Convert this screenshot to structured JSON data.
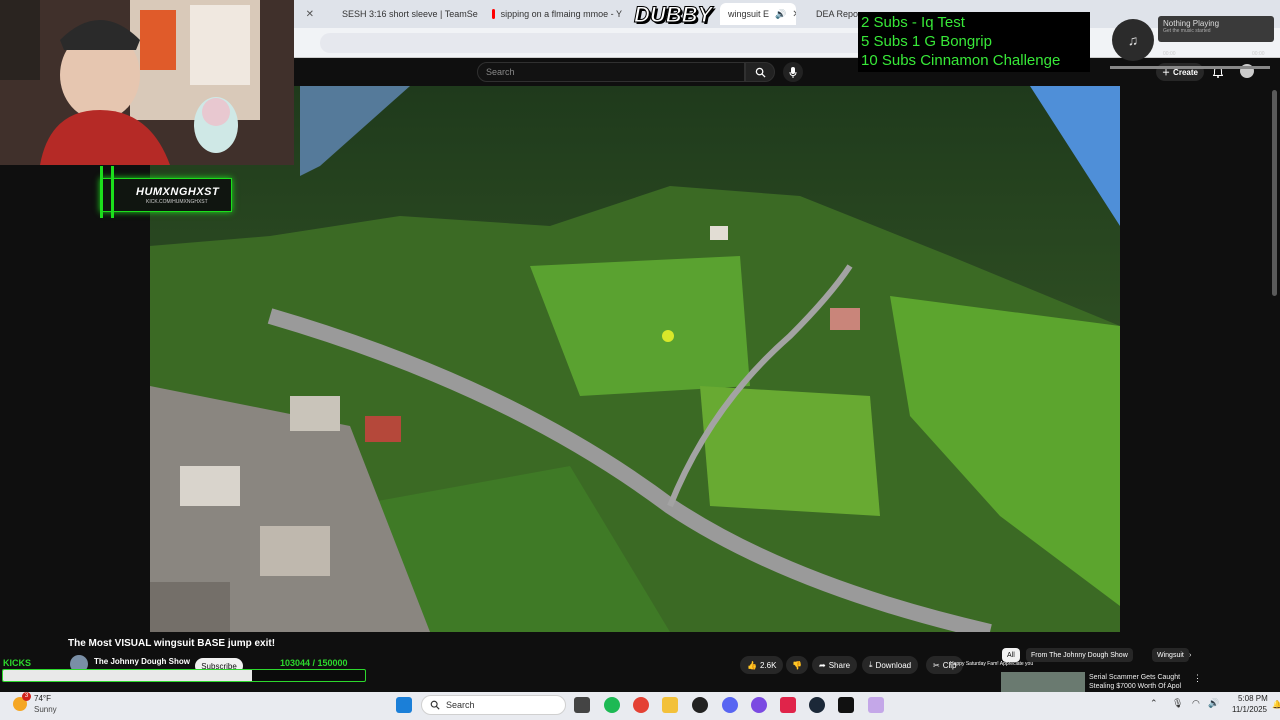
{
  "browser": {
    "tabs": [
      {
        "label": "SESH 3:16 short sleeve | TeamSe",
        "fav_color": "#888888"
      },
      {
        "label": "sipping on a flmaing mmoe - Y",
        "fav_color": "#ff0000"
      },
      {
        "label": "wingsuit E",
        "fav_color": "#ff0000"
      },
      {
        "label": "DEA Repo",
        "fav_color": "#1a73e8"
      }
    ]
  },
  "youtube": {
    "search_placeholder": "Search",
    "create_label": "Create",
    "video_title": "The Most VISUAL wingsuit BASE jump exit!",
    "channel_name": "The Johnny Dough Show",
    "subscribe_label": "Subscribe",
    "like_count": "2.6K",
    "share_label": "Share",
    "download_label": "Download",
    "clip_label": "Clip",
    "chips": [
      "All",
      "From The Johnny Dough Show",
      "Wingsuit"
    ],
    "rec_title": "Serial Scammer Gets Caught Stealing $7000 Worth Of Apol",
    "chat_overlay": "Happy Saturday Fam! Appreciate you"
  },
  "stream": {
    "streamer_name": "HUMXNGHXST",
    "streamer_url": "KICK.COM/HUMXNGHXST",
    "title_overlay": "DUBBY",
    "sub_goals": [
      "2 Subs - Iq Test",
      "5 Subs 1 G Bongrip",
      "10 Subs Cinnamon Challenge"
    ],
    "kicks_label": "KICKS",
    "kick_progress": "103044  / 150000",
    "kick_fraction": 0.687
  },
  "music_widget": {
    "title": "Nothing Playing",
    "subtitle": "Get the music started",
    "time_left": "00:00",
    "time_right": "00:00"
  },
  "taskbar": {
    "weather_temp": "74°F",
    "weather_cond": "Sunny",
    "weather_badge": "3",
    "search_label": "Search",
    "time": "5:08 PM",
    "date": "11/1/2025"
  }
}
